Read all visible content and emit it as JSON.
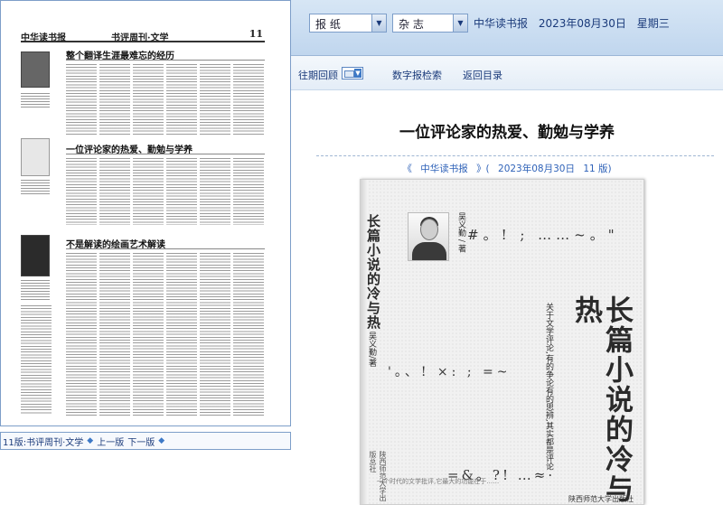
{
  "paper": {
    "logo": "中华读书报",
    "rubric": "书评周刊·文学",
    "page_number": "11",
    "articles": [
      {
        "headline": "整个翻译生涯最难忘的经历"
      },
      {
        "headline": "一位评论家的热爱、勤勉与学养"
      },
      {
        "headline": "不是解读的绘画艺术解读"
      }
    ]
  },
  "paper_nav": {
    "page_label": "11版:书评周刊·文学",
    "prev_label": "上一版",
    "next_label": "下一版"
  },
  "topbar": {
    "select_newspaper": "报  纸",
    "select_magazine": "杂  志",
    "publication": "中华读书报",
    "date": "2023年08月30日",
    "weekday": "星期三"
  },
  "toolbar": {
    "history_label": "往期回顾",
    "digital_search_label": "数字报检索",
    "back_label": "返回目录"
  },
  "article": {
    "title": "一位评论家的热爱、勤勉与学养",
    "source_open": "《",
    "source_name": "中华读书报",
    "source_close": "》(",
    "source_date": "2023年08月30日",
    "source_page": "11  版)"
  },
  "cover": {
    "title_small": "长篇小说的冷与热",
    "author_small": "吴义勤/著",
    "title_big": "长篇小说的冷与热",
    "subtitle": "关于文学评论,有的争论有的思辨,其实都是评论",
    "author": "吴义勤 / 著",
    "punct_top": "#。! ; ……~。\"",
    "punct_mid": "'。、! ×: ; =~",
    "punct_bottom": "=&。?! …≈·",
    "blurb": "一个时代的文学批评,它最大的功能在于……",
    "press": "陕西师范大学出版社",
    "publisher_vertical": "陕西师范大学出版总社"
  }
}
